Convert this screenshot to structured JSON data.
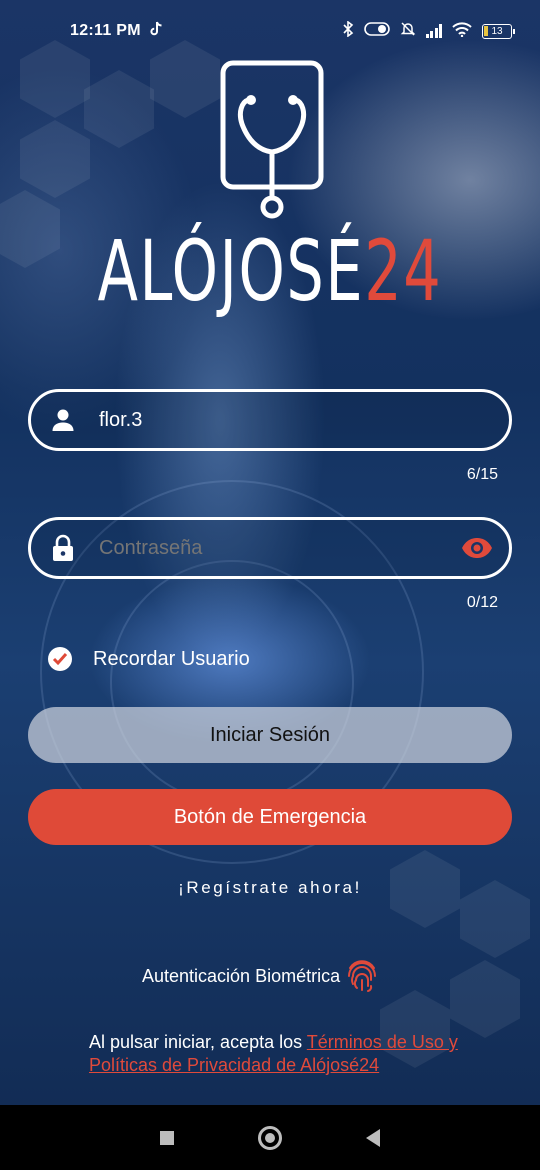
{
  "status_bar": {
    "time": "12:11 PM",
    "battery": "13",
    "icons": [
      "tiktok-icon",
      "bluetooth-icon",
      "toggle-icon",
      "bell-off-icon",
      "signal-icon",
      "wifi-icon",
      "battery-icon"
    ]
  },
  "brand": {
    "name_white": "ALÓJOSÉ",
    "name_red": "24",
    "accent_color": "#e04a3b"
  },
  "login": {
    "username_value": "flor.3",
    "username_counter": "6/15",
    "password_placeholder": "Contraseña",
    "password_counter": "0/12",
    "remember_label": "Recordar Usuario",
    "remember_checked": true,
    "login_button": "Iniciar Sesión",
    "emergency_button": "Botón de Emergencia",
    "register_link": "¡Regístrate ahora!",
    "biometric_label": "Autenticación Biométrica"
  },
  "terms": {
    "prefix": "Al pulsar iniciar, acepta los ",
    "link": "Términos de Uso y Políticas de Privacidad de Alójosé24"
  },
  "nav": {
    "icons": [
      "recents-square-icon",
      "home-circle-icon",
      "back-triangle-icon"
    ]
  }
}
